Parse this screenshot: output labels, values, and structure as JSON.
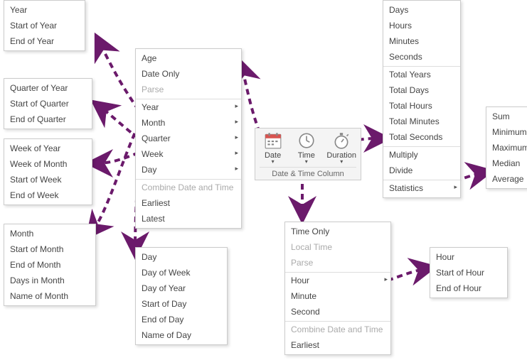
{
  "ribbon": {
    "group_title": "Date & Time Column",
    "buttons": {
      "date": "Date",
      "time": "Time",
      "duration": "Duration"
    }
  },
  "menus": {
    "year": {
      "items": [
        "Year",
        "Start of Year",
        "End of Year"
      ]
    },
    "quarter": {
      "items": [
        "Quarter of Year",
        "Start of Quarter",
        "End of Quarter"
      ]
    },
    "week": {
      "items": [
        "Week of Year",
        "Week of Month",
        "Start of Week",
        "End of Week"
      ]
    },
    "month": {
      "items": [
        "Month",
        "Start of Month",
        "End of Month",
        "Days in Month",
        "Name of Month"
      ]
    },
    "day": {
      "items": [
        "Day",
        "Day of Week",
        "Day of Year",
        "Start of Day",
        "End of Day",
        "Name of Day"
      ]
    },
    "date_main": {
      "items": [
        {
          "label": "Age",
          "sub": false
        },
        {
          "label": "Date Only",
          "sub": false
        },
        {
          "label": "Parse",
          "sub": false,
          "disabled": true
        },
        {
          "label": "Year",
          "sub": true,
          "sep": true
        },
        {
          "label": "Month",
          "sub": true
        },
        {
          "label": "Quarter",
          "sub": true
        },
        {
          "label": "Week",
          "sub": true
        },
        {
          "label": "Day",
          "sub": true
        },
        {
          "label": "Combine Date and Time",
          "sub": false,
          "disabled": true,
          "sep": true
        },
        {
          "label": "Earliest",
          "sub": false
        },
        {
          "label": "Latest",
          "sub": false
        }
      ]
    },
    "time_main": {
      "items": [
        {
          "label": "Time Only",
          "sub": false
        },
        {
          "label": "Local Time",
          "sub": false,
          "disabled": true
        },
        {
          "label": "Parse",
          "sub": false,
          "disabled": true
        },
        {
          "label": "Hour",
          "sub": true,
          "sep": true
        },
        {
          "label": "Minute",
          "sub": false
        },
        {
          "label": "Second",
          "sub": false
        },
        {
          "label": "Combine Date and Time",
          "sub": false,
          "disabled": true,
          "sep": true
        },
        {
          "label": "Earliest",
          "sub": false
        }
      ]
    },
    "hour": {
      "items": [
        "Hour",
        "Start of Hour",
        "End of Hour"
      ]
    },
    "duration": {
      "items": [
        {
          "label": "Days",
          "sub": false
        },
        {
          "label": "Hours",
          "sub": false
        },
        {
          "label": "Minutes",
          "sub": false
        },
        {
          "label": "Seconds",
          "sub": false
        },
        {
          "label": "Total Years",
          "sub": false,
          "sep": true
        },
        {
          "label": "Total Days",
          "sub": false
        },
        {
          "label": "Total Hours",
          "sub": false
        },
        {
          "label": "Total Minutes",
          "sub": false
        },
        {
          "label": "Total Seconds",
          "sub": false
        },
        {
          "label": "Multiply",
          "sub": false,
          "sep": true
        },
        {
          "label": "Divide",
          "sub": false
        },
        {
          "label": "Statistics",
          "sub": true,
          "sep": true
        }
      ]
    },
    "stats": {
      "items": [
        "Sum",
        "Minimum",
        "Maximum",
        "Median",
        "Average"
      ]
    }
  }
}
